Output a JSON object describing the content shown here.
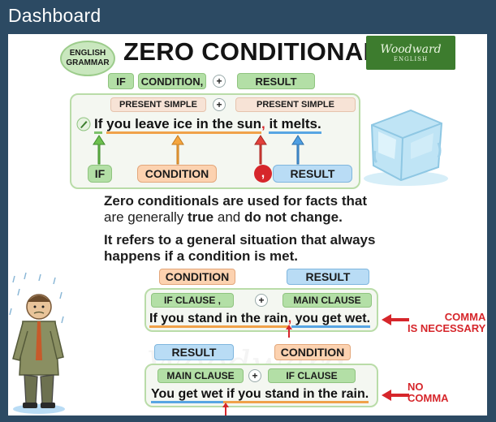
{
  "window": {
    "title": "Dashboard"
  },
  "header": {
    "badge_line1": "ENGLISH",
    "badge_line2": "GRAMMAR",
    "title": "ZERO CONDITIONAL",
    "brand": "Woodward",
    "brand_sub": "ENGLISH"
  },
  "formula": {
    "if": "IF",
    "condition": "CONDITION,",
    "plus": "+",
    "result": "RESULT"
  },
  "example1": {
    "tense_left": "PRESENT SIMPLE",
    "plus": "+",
    "tense_right": "PRESENT SIMPLE",
    "part_if": "If",
    "part_cond": "you leave ice in the sun",
    "comma": ",",
    "part_result": "it melts.",
    "label_if": "IF",
    "label_condition": "CONDITION",
    "label_comma": ",",
    "label_result": "RESULT"
  },
  "explanation": {
    "line1": "Zero conditionals are used for facts that",
    "line2_a": "are generally ",
    "line2_b": "true",
    "line2_c": " and ",
    "line2_d": "do not change",
    "line2_e": ".",
    "line3": "It refers to a general situation that always",
    "line4": "happens if a condition is met."
  },
  "example2": {
    "label_condition": "CONDITION",
    "label_result": "RESULT",
    "if_clause": "IF CLAUSE ,",
    "plus": "+",
    "main_clause": "MAIN CLAUSE",
    "sentence_a": "If you stand in the rain",
    "sentence_b": ",",
    "sentence_c": " you get wet.",
    "note_line1": "COMMA",
    "note_line2": "IS NECESSARY"
  },
  "example3": {
    "label_result": "RESULT",
    "label_condition": "CONDITION",
    "main_clause": "MAIN CLAUSE",
    "plus": "+",
    "if_clause": "IF CLAUSE",
    "sentence_a": "You get wet",
    "sentence_b": " if you stand in the rain.",
    "note_line1": "NO",
    "note_line2": "COMMA"
  },
  "colors": {
    "frame": "#2c4a63",
    "green": "#b3dfa6",
    "peach": "#fcd2b0",
    "blue": "#b9dcf5",
    "red": "#d6262b"
  }
}
